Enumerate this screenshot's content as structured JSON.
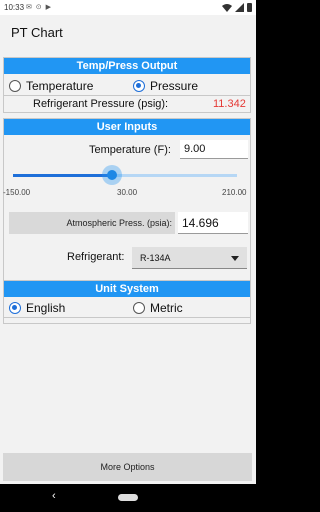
{
  "status_bar": {
    "time": "10:33",
    "notification_icons": "✉ ⊙ ▶"
  },
  "app_bar": {
    "title": "PT Chart"
  },
  "output_panel": {
    "header": "Temp/Press Output",
    "radio_temperature": "Temperature",
    "radio_pressure": "Pressure",
    "selected": "pressure",
    "result_label": "Refrigerant Pressure (psig):",
    "result_value": "11.342"
  },
  "inputs_panel": {
    "header": "User Inputs",
    "temperature_label": "Temperature (F):",
    "temperature_value": "9.00",
    "slider": {
      "min_label": "-150.00",
      "mid_label": "30.00",
      "max_label": "210.00",
      "value_fraction": 0.442
    },
    "atm_label": "Atmospheric Press. (psia):",
    "atm_value": "14.696",
    "refrigerant_label": "Refrigerant:",
    "refrigerant_value": "R-134A"
  },
  "unit_panel": {
    "header": "Unit System",
    "radio_english": "English",
    "radio_metric": "Metric",
    "selected": "english"
  },
  "more_options_label": "More Options",
  "nav": {
    "back_glyph": "‹"
  },
  "colors": {
    "accent": "#2196f3",
    "result_red": "#e53935"
  }
}
